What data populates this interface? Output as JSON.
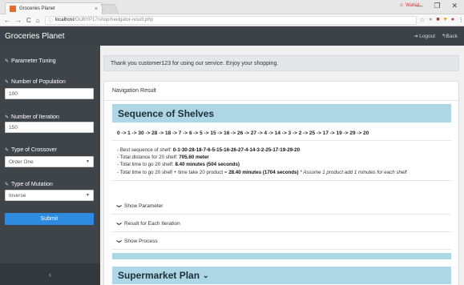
{
  "browser": {
    "tab_title": "Groceries Planet",
    "tab_close": "×",
    "profile_name": "Wahid",
    "win_minimize": "—",
    "win_restore": "❐",
    "win_close": "✕",
    "back": "←",
    "forward": "→",
    "reload": "C",
    "home": "⌂",
    "url_info": "ⓘ",
    "url_host": "localhost",
    "url_path": "/OUBYP17/shop/navigator-result.php",
    "star": "☆"
  },
  "app": {
    "brand": "Groceries Planet",
    "logout": "Logout",
    "back": "Back"
  },
  "sidebar": {
    "title": "Parameter Tuning",
    "population_label": "Number of Population",
    "population_value": "100",
    "iteration_label": "Number of Iteration",
    "iteration_value": "150",
    "crossover_label": "Type of Crossover",
    "crossover_value": "Order One",
    "mutation_label": "Type of Mutation",
    "mutation_value": "Inverse",
    "submit": "Submit",
    "collapse": "‹"
  },
  "main": {
    "alert": "Thank you customer123 for using our service. Enjoy your shopping.",
    "panel_title": "Navigation Result",
    "sequence_title": "Sequence of Shelves",
    "sequence": "0 -> 1 -> 30 -> 28 -> 18 -> 7 -> 6 -> 5 -> 15 -> 16 -> 26 -> 27 -> 4 -> 14 -> 3 -> 2 -> 25 -> 17 -> 19 -> 29 -> 20",
    "best_seq_prefix": "- Best sequence of shelf:",
    "best_seq_value": "0-1-30-28-18-7-6-5-15-16-26-27-4-14-3-2-25-17-19-29-20",
    "distance_prefix": "- Total distance for 20 shelf:",
    "distance_value": "705.60 meter",
    "time_prefix": "- Total time to go 20 shelf:",
    "time_value": "8.40 minutes (504 seconds)",
    "time2_prefix": "- Total time to go 20 shelf + time take 20 product =",
    "time2_value": "28.40 minutes (1704 seconds)",
    "time2_note": "* Assume 1 product add 1 minutes for each shelf",
    "show_parameter": "Show Parameter",
    "result_each": "Result for Each Iteration",
    "show_process": "Show Process",
    "market_title": "Supermarket Plan"
  }
}
